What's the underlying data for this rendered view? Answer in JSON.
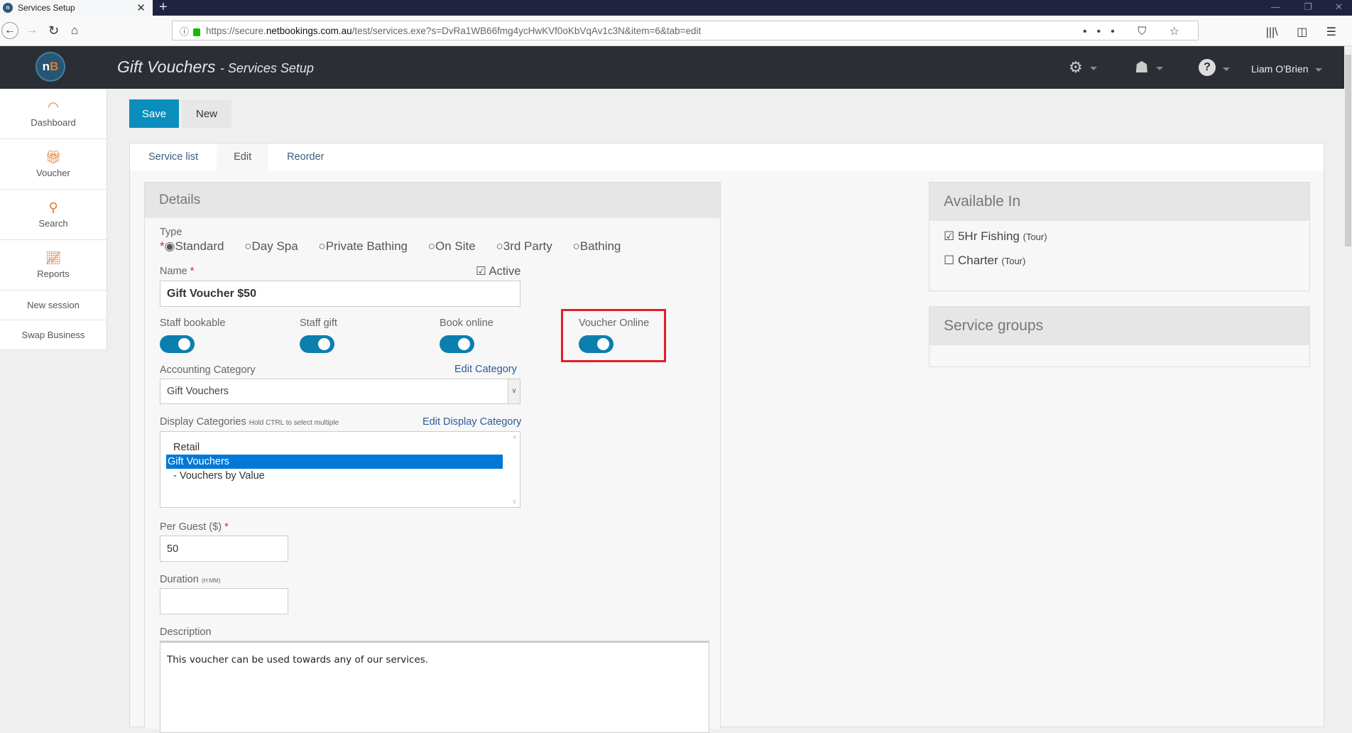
{
  "browser": {
    "tab_title": "Services Setup",
    "tab_close": "✕",
    "new_tab": "+",
    "url_prefix": "https://secure.",
    "url_domain": "netbookings.com.au",
    "url_path": "/test/services.exe?s=DvRa1WB66fmg4ycHwKVf0oKbVqAv1c3N&item=6&tab=edit",
    "window_controls": {
      "minimize": "—",
      "restore": "❐",
      "close": "✕"
    },
    "page_actions": "••• ⛉ ☆",
    "toolbar_icons": [
      "library-icon",
      "sidebar-icon",
      "menu-icon"
    ]
  },
  "header": {
    "logo_n": "n",
    "logo_b": "B",
    "title": "Gift Vouchers",
    "subtitle": "- Services Setup",
    "user_name": "Liam O'Brien",
    "icons": [
      "settings-icon",
      "ninja-icon",
      "help-icon"
    ]
  },
  "sidebar": {
    "items": [
      {
        "label": "Dashboard",
        "icon": "dashboard-icon"
      },
      {
        "label": "Voucher",
        "icon": "gift-icon"
      },
      {
        "label": "Search",
        "icon": "search-icon"
      },
      {
        "label": "Reports",
        "icon": "reports-icon"
      }
    ],
    "links": [
      {
        "label": "New session"
      },
      {
        "label": "Swap Business"
      }
    ]
  },
  "toolbar": {
    "save_label": "Save",
    "new_label": "New"
  },
  "tabs": [
    {
      "label": "Service list",
      "active": false
    },
    {
      "label": "Edit",
      "active": true
    },
    {
      "label": "Reorder",
      "active": false
    }
  ],
  "details": {
    "heading": "Details",
    "type_label": "Type",
    "type_options": [
      "Standard",
      "Day Spa",
      "Private Bathing",
      "On Site",
      "3rd Party",
      "Bathing"
    ],
    "type_selected": "Standard",
    "name_label": "Name",
    "name_value": "Gift Voucher $50",
    "active_label": "Active",
    "active_checked": true,
    "toggles": [
      {
        "label": "Staff bookable",
        "on": true
      },
      {
        "label": "Staff gift",
        "on": true
      },
      {
        "label": "Book online",
        "on": true
      },
      {
        "label": "Voucher Online",
        "on": true,
        "highlighted": true
      }
    ],
    "accounting_label": "Accounting Category",
    "accounting_edit": "Edit Category",
    "accounting_value": "Gift Vouchers",
    "display_label": "Display Categories",
    "display_hint": "Hold CTRL to select multiple",
    "display_edit": "Edit Display Category",
    "display_options": [
      {
        "label": "Retail",
        "selected": false
      },
      {
        "label": "Gift Vouchers",
        "selected": true
      },
      {
        "label": "- Vouchers by Value",
        "selected": false
      }
    ],
    "per_guest_label": "Per Guest ($)",
    "per_guest_value": "50",
    "duration_label": "Duration",
    "duration_hint": "(H:MM)",
    "duration_value": "",
    "description_label": "Description",
    "description_value": "This voucher can be used towards any of our services."
  },
  "available_in": {
    "heading": "Available In",
    "items": [
      {
        "label": "5Hr Fishing",
        "kind": "(Tour)",
        "checked": true
      },
      {
        "label": "Charter",
        "kind": "(Tour)",
        "checked": false
      }
    ]
  },
  "service_groups": {
    "heading": "Service groups"
  },
  "colors": {
    "primary": "#0b8ebd",
    "toggle": "#0b7fae",
    "accent": "#e07a2e",
    "header_bg": "#2c2e36",
    "highlight": "#e01e28",
    "selection": "#0078d7"
  }
}
